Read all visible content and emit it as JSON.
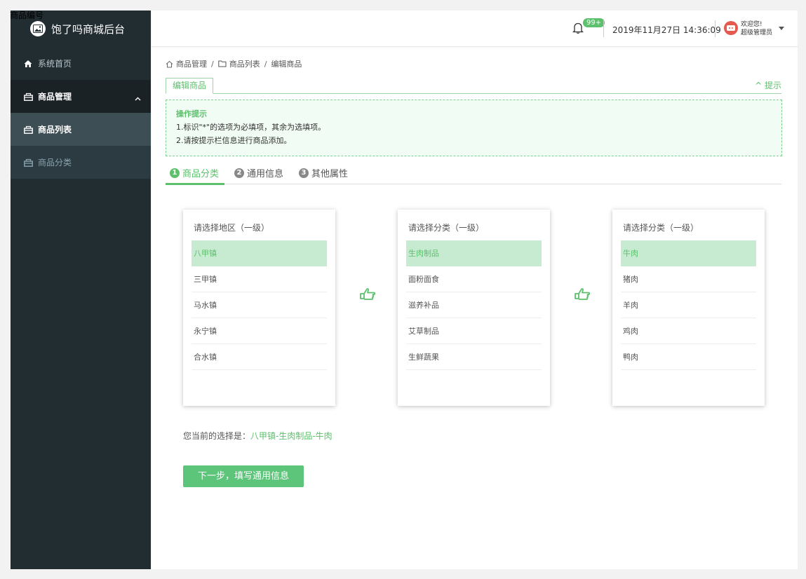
{
  "stray_label": "商品编号",
  "app": {
    "title": "饱了吗商城后台"
  },
  "sidebar": {
    "home": "系统首页",
    "group": "商品管理",
    "items": [
      "商品列表",
      "商品分类"
    ]
  },
  "header": {
    "badge": "99+",
    "datetime": "2019年11月27日 14:36:09",
    "welcome": "欢迎您!",
    "role": "超级管理员"
  },
  "breadcrumb": [
    "商品管理",
    "商品列表",
    "编辑商品"
  ],
  "tab": {
    "label": "编辑商品",
    "hint_toggle": "提示"
  },
  "tips": {
    "title": "操作提示",
    "lines": [
      "1.标识\"*\"的选项为必填项，其余为选填项。",
      "2.请按提示栏信息进行商品添加。"
    ]
  },
  "steps": [
    {
      "num": "1",
      "label": "商品分类"
    },
    {
      "num": "2",
      "label": "通用信息"
    },
    {
      "num": "3",
      "label": "其他属性"
    }
  ],
  "panels": [
    {
      "title": "请选择地区（一级）",
      "items": [
        "八甲镇",
        "三甲镇",
        "马水镇",
        "永宁镇",
        "合水镇"
      ],
      "selected": 0
    },
    {
      "title": "请选择分类（一级）",
      "items": [
        "生肉制品",
        "面粉面食",
        "滋养补品",
        "艾草制品",
        "生鲜蔬果"
      ],
      "selected": 0
    },
    {
      "title": "请选择分类（一级）",
      "items": [
        "牛肉",
        "猪肉",
        "羊肉",
        "鸡肉",
        "鸭肉"
      ],
      "selected": 0
    }
  ],
  "selection": {
    "label": "您当前的选择是：",
    "value": "八甲镇-生肉制品-牛肉"
  },
  "next_button": "下一步，填写通用信息",
  "colors": {
    "accent": "#5cc06c",
    "sidebar": "#222d32",
    "selected_bg": "#c6ebd1"
  }
}
